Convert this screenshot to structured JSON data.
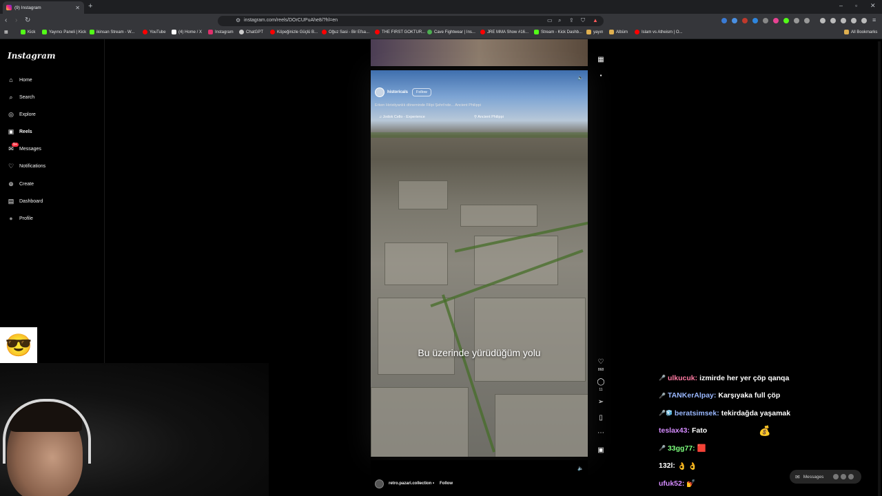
{
  "browser": {
    "tab_title": "(9) Instagram",
    "new_tab": "+",
    "url": "instagram.com/reels/DOrCUPuAhe8/?hl=en",
    "bookmarks": [
      {
        "label": "Kick",
        "color": "#53fc18"
      },
      {
        "label": "Yayıncı Paneli | Kick",
        "color": "#53fc18"
      },
      {
        "label": "ikinsan Stream - W...",
        "color": "#53fc18"
      },
      {
        "label": "YouTube",
        "color": "#ff0000"
      },
      {
        "label": "(4) Home / X",
        "color": "#ffffff"
      },
      {
        "label": "Instagram",
        "color": "#e1306c"
      },
      {
        "label": "ChatGPT",
        "color": "#cccccc"
      },
      {
        "label": "Köpeğinizle Güçlü B...",
        "color": "#ff0000"
      },
      {
        "label": "Oğuz Sasi - Bir Efsa...",
        "color": "#ff0000"
      },
      {
        "label": "THE FIRST GOKTUR...",
        "color": "#ff0000"
      },
      {
        "label": "Cave Fightwear | Ins...",
        "color": "#4caf50"
      },
      {
        "label": "JRE MMA Show #16...",
        "color": "#ff0000"
      },
      {
        "label": "Stream - Kick Dashb...",
        "color": "#53fc18"
      },
      {
        "label": "yayın",
        "color": "#e0b050"
      },
      {
        "label": "Albüm",
        "color": "#e0b050"
      },
      {
        "label": "Islam vs Atheism | O...",
        "color": "#ff0000"
      }
    ],
    "all_bookmarks": "All Bookmarks"
  },
  "sidebar": {
    "logo": "Instagram",
    "items": [
      {
        "label": "Home",
        "icon": "⌂"
      },
      {
        "label": "Search",
        "icon": "⌕"
      },
      {
        "label": "Explore",
        "icon": "◎"
      },
      {
        "label": "Reels",
        "icon": "▣"
      },
      {
        "label": "Messages",
        "icon": "✉",
        "badge": "9+"
      },
      {
        "label": "Notifications",
        "icon": "♡"
      },
      {
        "label": "Create",
        "icon": "⊕"
      },
      {
        "label": "Dashboard",
        "icon": "▤"
      },
      {
        "label": "Profile",
        "icon": "●"
      }
    ]
  },
  "reel": {
    "username": "historicals",
    "follow": "Follow",
    "caption": "Erken Hıristiyanlık döneminde Filipi Şehri'nde...   Ancient Philippi",
    "audio": "♫ Jodok Cello - Experience",
    "location": "⚲ Ancient Philippi",
    "subtitle": "Bu üzerinde yürüdüğüm yolu",
    "likes": "868",
    "comments": "11"
  },
  "next_reel": {
    "username": "retro.pazari.collection",
    "dot": "•",
    "follow": "Follow"
  },
  "chat": [
    {
      "badge": "🎤",
      "user": "ulkucuk:",
      "color": "#ff7aa2",
      "message": "izmirde her yer çöp qanqa"
    },
    {
      "badge": "🎤",
      "user": "TANKerAlpay:",
      "color": "#9ab8ff",
      "message": "Karşıyaka full çöp"
    },
    {
      "badge": "🎤🧊",
      "user": "beratsimsek:",
      "color": "#9ab8ff",
      "message": "tekirdağda yaşamak"
    },
    {
      "badge": "",
      "user": "teslax43:",
      "color": "#d58cff",
      "message": "Fato"
    },
    {
      "badge": "🎤",
      "user": "33gg77:",
      "color": "#7dff7d",
      "message": "🟥"
    },
    {
      "badge": "",
      "user": "132l:",
      "color": "#ffffff",
      "message": "👌 👌"
    },
    {
      "badge": "",
      "user": "ufuk52:",
      "color": "#d58cff",
      "message": "💅"
    }
  ],
  "messages_button": "Messages",
  "colors": {
    "accent": "#ff3040",
    "background": "#000000"
  }
}
